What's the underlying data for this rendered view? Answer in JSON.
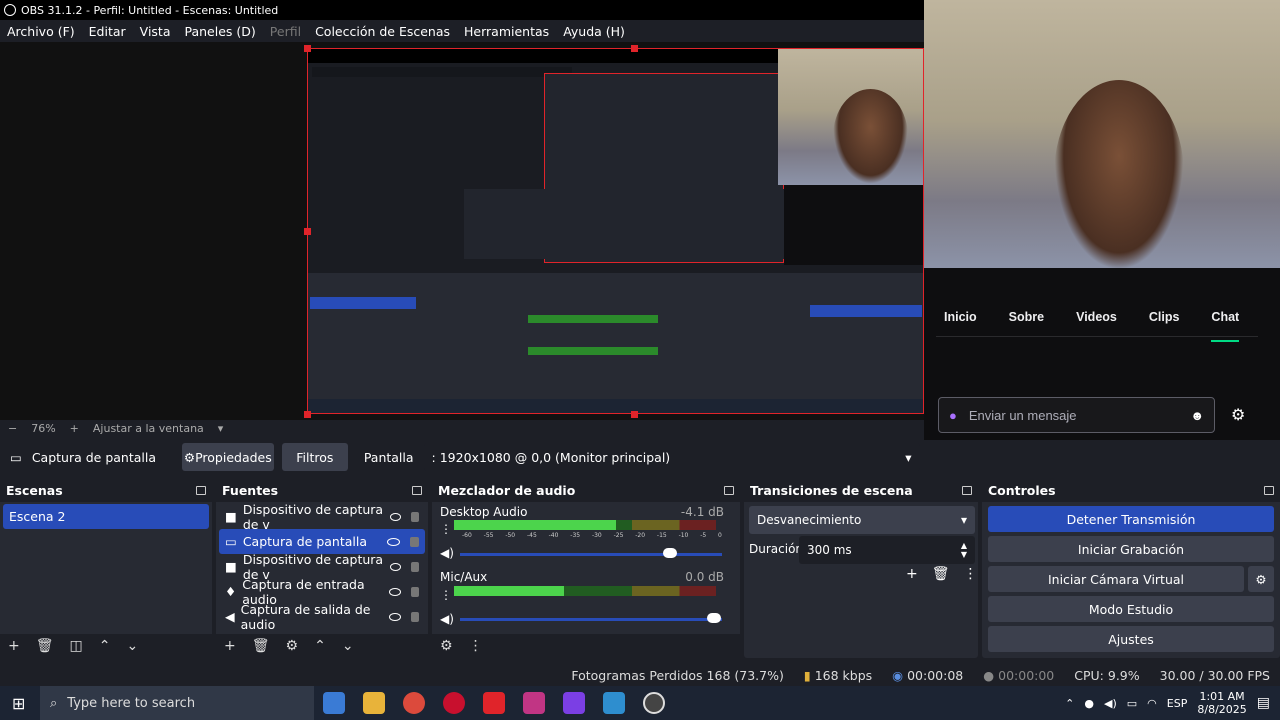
{
  "window": {
    "title": "OBS 31.1.2 - Perfil: Untitled - Escenas: Untitled"
  },
  "menu": [
    "Archivo (F)",
    "Editar",
    "Vista",
    "Paneles (D)",
    "Perfil",
    "Colección de Escenas",
    "Herramientas",
    "Ayuda (H)"
  ],
  "preview": {
    "zoom": "76%",
    "fit": "Ajustar a la ventana"
  },
  "chat": {
    "tabs": [
      "Inicio",
      "Sobre",
      "Videos",
      "Clips",
      "Chat"
    ],
    "active": "Chat",
    "placeholder": "Enviar un mensaje"
  },
  "sourcebar": {
    "source_name": "Captura de pantalla",
    "properties": "Propiedades",
    "filters": "Filtros",
    "display_label": "Pantalla",
    "display_value": ": 1920x1080 @ 0,0 (Monitor principal)"
  },
  "scenes": {
    "title": "Escenas",
    "items": [
      "Escena 2"
    ]
  },
  "sources": {
    "title": "Fuentes",
    "items": [
      "Dispositivo de captura de v",
      "Captura de pantalla",
      "Dispositivo de captura de v",
      "Captura de entrada audio",
      "Captura de salida de audio"
    ],
    "selected_index": 1
  },
  "mixer": {
    "title": "Mezclador de audio",
    "tracks": [
      {
        "name": "Desktop Audio",
        "db": "-4.1 dB",
        "level": 0.62,
        "volume": 0.8
      },
      {
        "name": "Mic/Aux",
        "db": "0.0 dB",
        "level": 0.42,
        "volume": 0.97
      }
    ],
    "scale": [
      "-60",
      "-55",
      "-50",
      "-45",
      "-40",
      "-35",
      "-30",
      "-25",
      "-20",
      "-15",
      "-10",
      "-5",
      "0"
    ]
  },
  "transitions": {
    "title": "Transiciones de escena",
    "selected": "Desvanecimiento",
    "duration_label": "Duración",
    "duration": "300 ms"
  },
  "controls": {
    "title": "Controles",
    "stop_stream": "Detener Transmisión",
    "start_recording": "Iniciar Grabación",
    "start_virtualcam": "Iniciar Cámara Virtual",
    "studio_mode": "Modo Estudio",
    "settings": "Ajustes"
  },
  "status": {
    "dropped": "Fotogramas Perdidos 168 (73.7%)",
    "bitrate": "168 kbps",
    "stream_time": "00:00:08",
    "rec_time": "00:00:00",
    "cpu": "CPU: 9.9%",
    "fps": "30.00 / 30.00 FPS"
  },
  "taskbar": {
    "search_placeholder": "Type here to search",
    "lang": "ESP",
    "time": "1:01 AM",
    "date": "8/8/2025"
  },
  "colors": {
    "accent": "#284cb8",
    "selection": "#e0242a",
    "twitch": "#00db84"
  }
}
